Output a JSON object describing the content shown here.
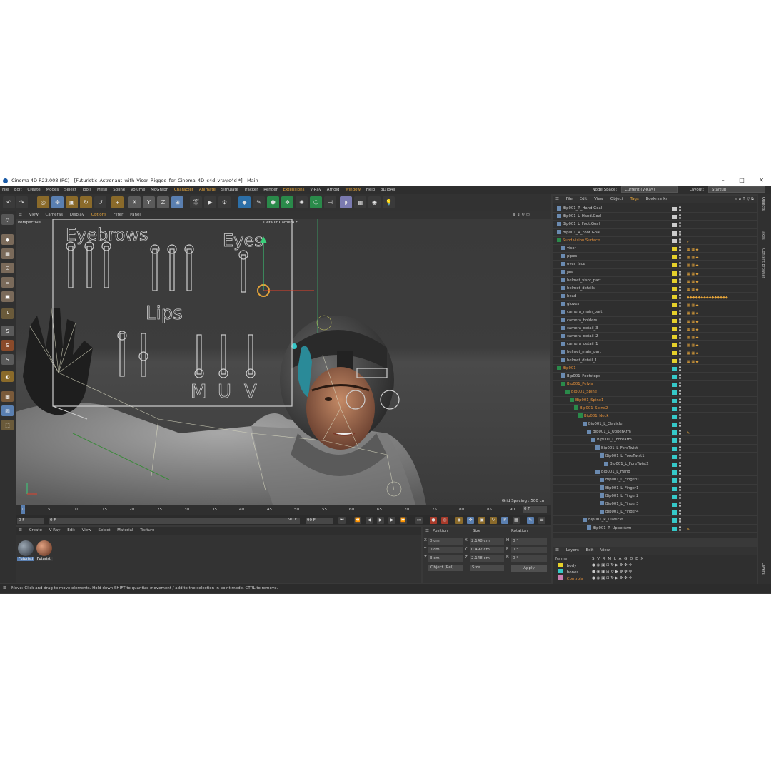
{
  "window": {
    "title": "Cinema 4D R23.008 (RC) - [Futuristic_Astronaut_with_Visor_Rigged_for_Cinema_4D_c4d_vray.c4d *] - Main",
    "controls": [
      "–",
      "□",
      "✕"
    ]
  },
  "menubar": {
    "items": [
      "File",
      "Edit",
      "Create",
      "Modes",
      "Select",
      "Tools",
      "Mesh",
      "Spline",
      "Volume",
      "MoGraph",
      "Character",
      "Animate",
      "Simulate",
      "Tracker",
      "Render",
      "Extensions",
      "V-Ray",
      "Arnold",
      "Window",
      "Help",
      "3DToAll"
    ],
    "node_space_label": "Node Space:",
    "node_space_value": "Current (V-Ray)",
    "layout_label": "Layout:",
    "layout_value": "Startup"
  },
  "viewport_menu": {
    "items": [
      "View",
      "Cameras",
      "Display",
      "Options",
      "Filter",
      "Panel"
    ]
  },
  "viewport": {
    "view_name": "Perspective",
    "camera": "Default Camera *",
    "grid_spacing": "Grid Spacing : 500 cm",
    "rig_labels": [
      "Eyebrows",
      "Eyes",
      "Lips",
      "M",
      "U",
      "V"
    ]
  },
  "timeline": {
    "ticks": [
      "0",
      "5",
      "10",
      "15",
      "20",
      "25",
      "30",
      "35",
      "40",
      "45",
      "50",
      "55",
      "60",
      "65",
      "70",
      "75",
      "80",
      "85",
      "90"
    ],
    "current_frame": "0 F"
  },
  "transport": {
    "start": "0 F",
    "current": "0 F",
    "end": "90 F",
    "end2": "90 F"
  },
  "material_panel": {
    "menu": [
      "Create",
      "V-Ray",
      "Edit",
      "View",
      "Select",
      "Material",
      "Texture"
    ],
    "materials": [
      {
        "name": "Futuristi",
        "color": "#5a6470"
      },
      {
        "name": "Futuristi",
        "color": "#9a5a40"
      }
    ]
  },
  "coordinates": {
    "headers": [
      "Position",
      "Size",
      "Rotation"
    ],
    "rows": [
      {
        "axis": "X",
        "pos": "0 cm",
        "saxis": "X",
        "size": "2.148 cm",
        "raxis": "H",
        "rot": "0 °"
      },
      {
        "axis": "Y",
        "pos": "0 cm",
        "saxis": "Y",
        "size": "0.492 cm",
        "raxis": "P",
        "rot": "0 °"
      },
      {
        "axis": "Z",
        "pos": "3 cm",
        "saxis": "Z",
        "size": "2.148 cm",
        "raxis": "B",
        "rot": "0 °"
      }
    ],
    "mode": "Object (Rel)",
    "size_mode": "Size",
    "apply": "Apply"
  },
  "status": {
    "text": "Move: Click and drag to move elements. Hold down SHIFT to quantize movement / add to the selection in point mode, CTRL to remove."
  },
  "objects_panel": {
    "menu": [
      "File",
      "Edit",
      "View",
      "Object",
      "Tags",
      "Bookmarks"
    ],
    "rows": [
      {
        "name": "Bip001_R_Hand.Goal",
        "indent": 0,
        "orange": false,
        "color": "#cccccc",
        "tags": ""
      },
      {
        "name": "Bip001_L_Hand.Goal",
        "indent": 0,
        "orange": false,
        "color": "#cccccc",
        "tags": ""
      },
      {
        "name": "Bip001_L_Foot.Goal",
        "indent": 0,
        "orange": false,
        "color": "#cccccc",
        "tags": ""
      },
      {
        "name": "Bip001_R_Foot.Goal",
        "indent": 0,
        "orange": false,
        "color": "#cccccc",
        "tags": ""
      },
      {
        "name": "Subdivision Surface",
        "indent": 0,
        "orange": true,
        "color": "#cccccc",
        "tags": "✓"
      },
      {
        "name": "visor",
        "indent": 1,
        "orange": false,
        "color": "#e5d02a",
        "tags": "▦ ▦ ◆"
      },
      {
        "name": "pipes",
        "indent": 1,
        "orange": false,
        "color": "#e5d02a",
        "tags": "▦ ▦ ◆"
      },
      {
        "name": "over_face",
        "indent": 1,
        "orange": false,
        "color": "#e5d02a",
        "tags": "▦ ▦ ◆"
      },
      {
        "name": "Jaw",
        "indent": 1,
        "orange": false,
        "color": "#e5d02a",
        "tags": "▦ ▦ ◆"
      },
      {
        "name": "helmet_visor_part",
        "indent": 1,
        "orange": false,
        "color": "#e5d02a",
        "tags": "▦ ▦ ◆"
      },
      {
        "name": "helmet_details",
        "indent": 1,
        "orange": false,
        "color": "#e5d02a",
        "tags": "▦ ▦ ◆"
      },
      {
        "name": "head",
        "indent": 1,
        "orange": false,
        "color": "#e5d02a",
        "tags": "◆◆◆◆◆◆◆◆◆◆◆◆◆◆◆"
      },
      {
        "name": "gloves",
        "indent": 1,
        "orange": false,
        "color": "#e5d02a",
        "tags": "▦ ▦ ◆"
      },
      {
        "name": "camera_main_part",
        "indent": 1,
        "orange": false,
        "color": "#e5d02a",
        "tags": "▦ ▦ ◆"
      },
      {
        "name": "camera_holders",
        "indent": 1,
        "orange": false,
        "color": "#e5d02a",
        "tags": "▦ ▦ ◆"
      },
      {
        "name": "camera_detail_3",
        "indent": 1,
        "orange": false,
        "color": "#e5d02a",
        "tags": "▦ ▦ ◆"
      },
      {
        "name": "camera_detail_2",
        "indent": 1,
        "orange": false,
        "color": "#e5d02a",
        "tags": "▦ ▦ ◆"
      },
      {
        "name": "camera_detail_1",
        "indent": 1,
        "orange": false,
        "color": "#e5d02a",
        "tags": "▦ ▦ ◆"
      },
      {
        "name": "helmet_main_part",
        "indent": 1,
        "orange": false,
        "color": "#e5d02a",
        "tags": "▦ ▦ ◆"
      },
      {
        "name": "helmet_detail_1",
        "indent": 1,
        "orange": false,
        "color": "#e5d02a",
        "tags": "▦ ▦ ◆"
      },
      {
        "name": "Bip001",
        "indent": 0,
        "orange": true,
        "color": "#35c8c8",
        "tags": ""
      },
      {
        "name": "Bip001_Footsteps",
        "indent": 1,
        "orange": false,
        "color": "#35c8c8",
        "tags": ""
      },
      {
        "name": "Bip001_Pelvis",
        "indent": 1,
        "orange": true,
        "color": "#35c8c8",
        "tags": ""
      },
      {
        "name": "Bip001_Spine",
        "indent": 2,
        "orange": true,
        "color": "#35c8c8",
        "tags": ""
      },
      {
        "name": "Bip001_Spine1",
        "indent": 3,
        "orange": true,
        "color": "#35c8c8",
        "tags": ""
      },
      {
        "name": "Bip001_Spine2",
        "indent": 4,
        "orange": true,
        "color": "#35c8c8",
        "tags": ""
      },
      {
        "name": "Bip001_Neck",
        "indent": 5,
        "orange": true,
        "color": "#35c8c8",
        "tags": ""
      },
      {
        "name": "Bip001_L_Clavicle",
        "indent": 6,
        "orange": false,
        "color": "#35c8c8",
        "tags": ""
      },
      {
        "name": "Bip001_L_UpperArm",
        "indent": 7,
        "orange": false,
        "color": "#35c8c8",
        "tags": "✎"
      },
      {
        "name": "Bip001_L_Forearm",
        "indent": 8,
        "orange": false,
        "color": "#35c8c8",
        "tags": ""
      },
      {
        "name": "Bip001_L_ForeTwist",
        "indent": 9,
        "orange": false,
        "color": "#35c8c8",
        "tags": ""
      },
      {
        "name": "Bip001_L_ForeTwist1",
        "indent": 10,
        "orange": false,
        "color": "#35c8c8",
        "tags": ""
      },
      {
        "name": "Bip001_L_ForeTwist2",
        "indent": 11,
        "orange": false,
        "color": "#35c8c8",
        "tags": ""
      },
      {
        "name": "Bip001_L_Hand",
        "indent": 9,
        "orange": false,
        "color": "#35c8c8",
        "tags": ""
      },
      {
        "name": "Bip001_L_Finger0",
        "indent": 10,
        "orange": false,
        "color": "#35c8c8",
        "tags": ""
      },
      {
        "name": "Bip001_L_Finger1",
        "indent": 10,
        "orange": false,
        "color": "#35c8c8",
        "tags": ""
      },
      {
        "name": "Bip001_L_Finger2",
        "indent": 10,
        "orange": false,
        "color": "#35c8c8",
        "tags": ""
      },
      {
        "name": "Bip001_L_Finger3",
        "indent": 10,
        "orange": false,
        "color": "#35c8c8",
        "tags": ""
      },
      {
        "name": "Bip001_L_Finger4",
        "indent": 10,
        "orange": false,
        "color": "#35c8c8",
        "tags": ""
      },
      {
        "name": "Bip001_R_Clavicle",
        "indent": 6,
        "orange": false,
        "color": "#35c8c8",
        "tags": ""
      },
      {
        "name": "Bip001_R_UpperArm",
        "indent": 7,
        "orange": false,
        "color": "#35c8c8",
        "tags": "✎"
      }
    ]
  },
  "layers_panel": {
    "menu": [
      "Layers",
      "Edit",
      "View"
    ],
    "header_name": "Name",
    "header_flags": "S V R M L A G D E X",
    "layers": [
      {
        "name": "body",
        "color": "#e5d02a",
        "orange": false
      },
      {
        "name": "bones",
        "color": "#35c8c8",
        "orange": false
      },
      {
        "name": "Controls",
        "color": "#c87fb0",
        "orange": true
      }
    ]
  },
  "right_tabs": [
    "Objects",
    "Takes",
    "Content Browser",
    "Layers"
  ],
  "colors": {
    "accent": "#e6a53a",
    "bg": "#393939",
    "selection": "#5a7fb0"
  }
}
